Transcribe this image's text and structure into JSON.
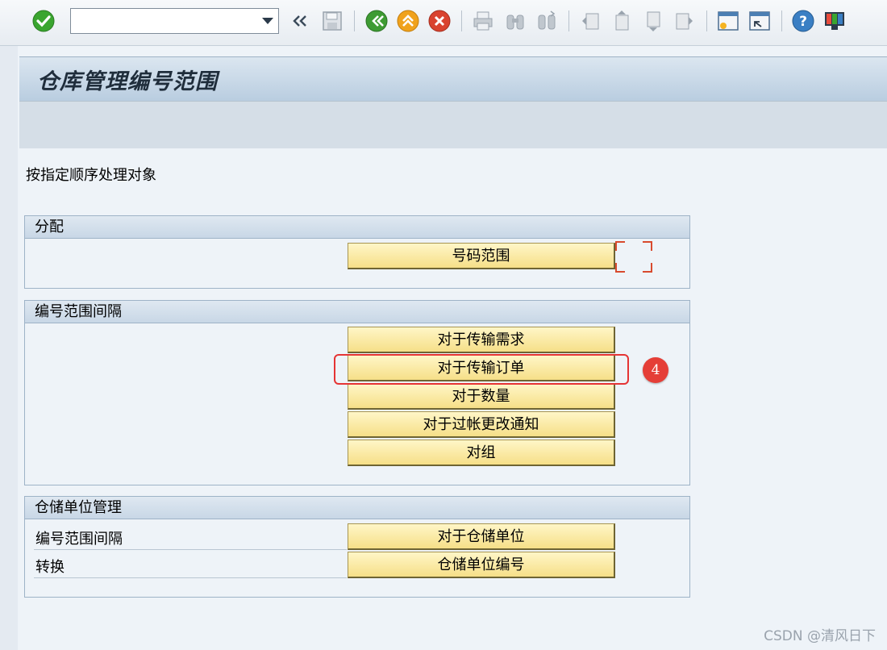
{
  "toolbar": {
    "command_field_value": "",
    "icons": [
      "enter-check-icon",
      "back-nav-icon",
      "save-icon",
      "back-icon",
      "exit-icon",
      "cancel-icon",
      "print-icon",
      "find-icon",
      "find-next-icon",
      "first-page-icon",
      "previous-page-icon",
      "next-page-icon",
      "last-page-icon",
      "create-session-icon",
      "shortcut-icon",
      "help-icon",
      "customize-layout-icon"
    ]
  },
  "page": {
    "title": "仓库管理编号范围",
    "instruction": "按指定顺序处理对象"
  },
  "groups": {
    "assignment": {
      "header": "分配",
      "buttons": [
        "号码范围"
      ]
    },
    "intervals": {
      "header": "编号范围间隔",
      "buttons": [
        "对于传输需求",
        "对于传输订单",
        "对于数量",
        "对于过帐更改通知",
        "对组"
      ]
    },
    "storage_unit": {
      "header": "仓储单位管理",
      "rows": [
        {
          "label": "编号范围间隔",
          "button": "对于仓储单位"
        },
        {
          "label": "转换",
          "button": "仓储单位编号"
        }
      ]
    }
  },
  "annotation": {
    "step": "4"
  },
  "watermark": "CSDN @清风日下",
  "colors": {
    "accent_green": "#3aa52f",
    "accent_orange": "#f0a21c",
    "accent_red": "#d9432f",
    "button_yellow": "#f6df88",
    "highlight_red": "#e53434"
  }
}
